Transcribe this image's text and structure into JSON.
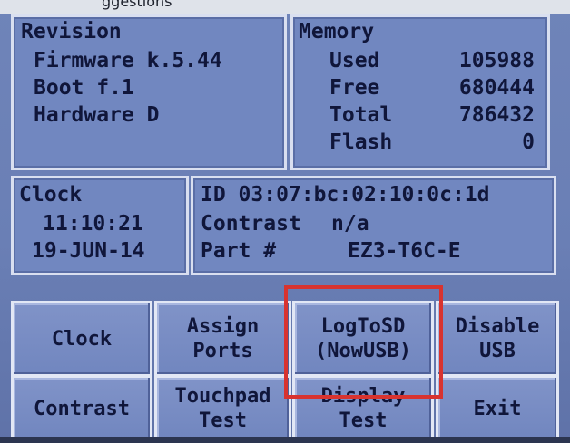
{
  "top_fragment": "ggestions",
  "revision": {
    "title": "Revision",
    "rows": [
      {
        "label": "Firmware k.5.44"
      },
      {
        "label": "Boot f.1"
      },
      {
        "label": "Hardware D"
      }
    ]
  },
  "memory": {
    "title": "Memory",
    "rows": [
      {
        "label": "Used",
        "value": "105988"
      },
      {
        "label": "Free",
        "value": "680444"
      },
      {
        "label": "Total",
        "value": "786432"
      },
      {
        "label": "Flash",
        "value": "0"
      }
    ]
  },
  "clock_panel": {
    "title": "Clock",
    "time": "11:10:21",
    "date": "19-JUN-14"
  },
  "info_panel": {
    "id_line": "ID 03:07:bc:02:10:0c:1d",
    "contrast_label": "Contrast",
    "contrast_value": "n/a",
    "part_label": "Part #",
    "part_value": "EZ3-T6C-E"
  },
  "buttons": {
    "clock": [
      "Clock"
    ],
    "assign_ports": [
      "Assign",
      "Ports"
    ],
    "log_to_sd": [
      "LogToSD",
      "(NowUSB)"
    ],
    "disable_usb": [
      "Disable",
      "USB"
    ],
    "contrast": [
      "Contrast"
    ],
    "touchpad_test": [
      "Touchpad",
      "Test"
    ],
    "display_test": [
      "Display",
      "Test"
    ],
    "exit": [
      "Exit"
    ]
  },
  "colors": {
    "annotation_box": "#d8332f",
    "panel_bg": "#7187c0",
    "text": "#10163a"
  }
}
